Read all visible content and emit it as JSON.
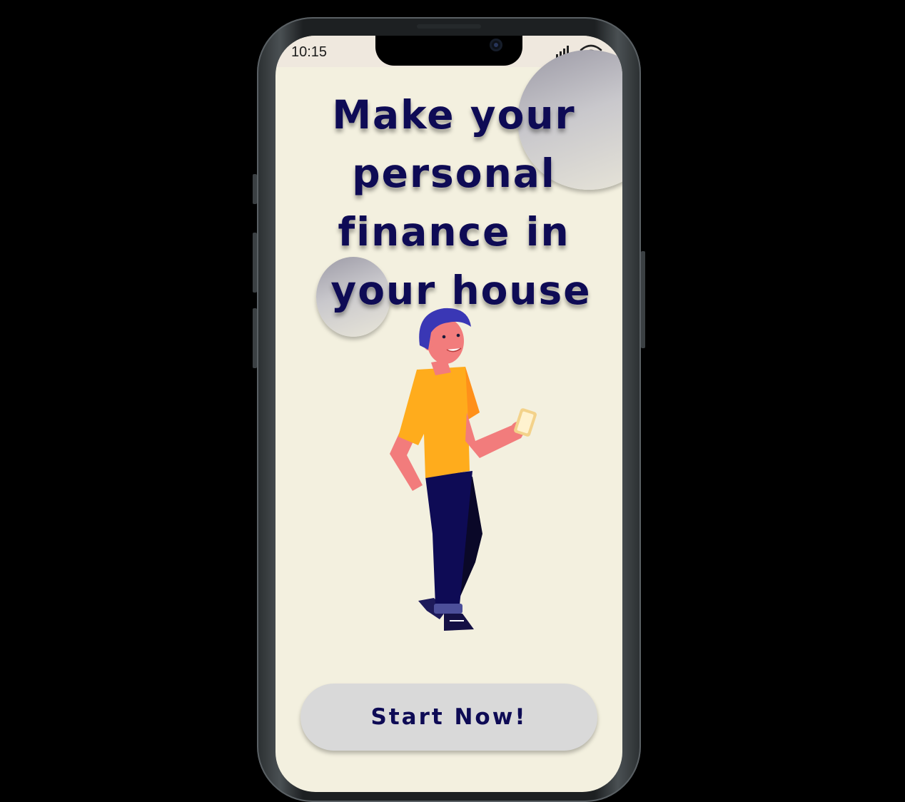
{
  "status_bar": {
    "time": "10:15",
    "signal_icon": "cellular-signal-icon",
    "wifi_icon": "wifi-icon"
  },
  "hero": {
    "headline_lines": [
      "Make your",
      "personal",
      "finance in",
      "your house"
    ],
    "illustration": "man-holding-phone-illustration"
  },
  "cta": {
    "label": "Start Now!"
  },
  "colors": {
    "background": "#f3f0df",
    "headline": "#0e0b55",
    "button_bg": "#d9d9d9",
    "shirt": "#ffac1c",
    "pants": "#0e0b55",
    "hair": "#3a37b5",
    "skin": "#f27c7c"
  }
}
